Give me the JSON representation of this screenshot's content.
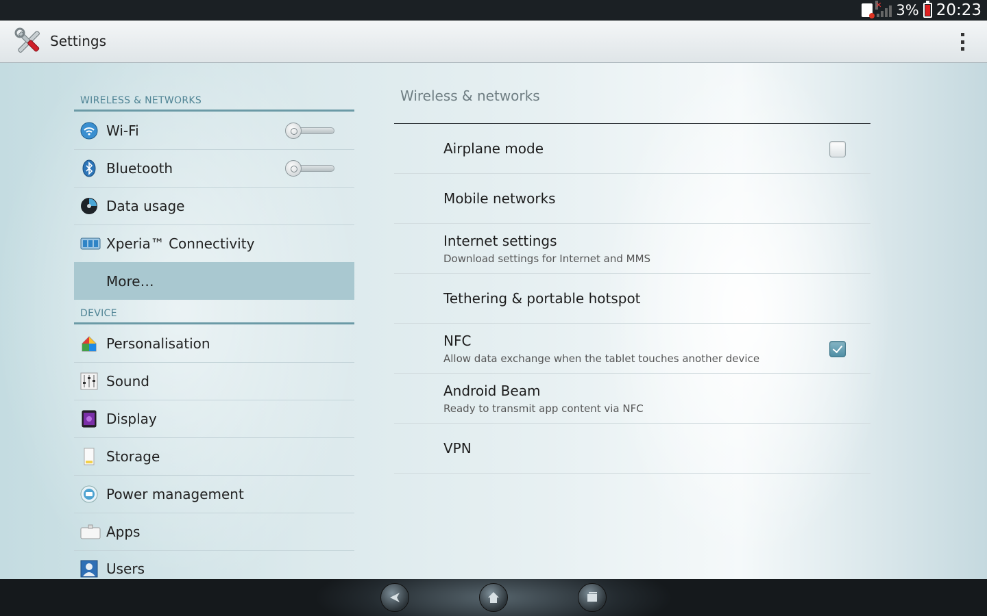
{
  "status_bar": {
    "battery_percent": "3%",
    "time": "20:23",
    "icons": [
      "sim-missing-icon",
      "signal-icon",
      "battery-low-icon"
    ]
  },
  "action_bar": {
    "title": "Settings",
    "icon": "settings-tools-icon",
    "overflow_icon": "overflow-menu-icon"
  },
  "left_pane": {
    "categories": [
      {
        "header": "WIRELESS & NETWORKS",
        "items": [
          {
            "label": "Wi-Fi",
            "icon": "wifi-icon",
            "toggle": "off"
          },
          {
            "label": "Bluetooth",
            "icon": "bluetooth-icon",
            "toggle": "off"
          },
          {
            "label": "Data usage",
            "icon": "data-usage-icon"
          },
          {
            "label": "Xperia™ Connectivity",
            "icon": "connectivity-icon"
          },
          {
            "label": "More…",
            "selected": true
          }
        ]
      },
      {
        "header": "DEVICE",
        "items": [
          {
            "label": "Personalisation",
            "icon": "personalisation-icon"
          },
          {
            "label": "Sound",
            "icon": "sound-icon"
          },
          {
            "label": "Display",
            "icon": "display-icon"
          },
          {
            "label": "Storage",
            "icon": "storage-icon"
          },
          {
            "label": "Power management",
            "icon": "power-management-icon"
          },
          {
            "label": "Apps",
            "icon": "apps-icon"
          },
          {
            "label": "Users",
            "icon": "users-icon"
          }
        ]
      }
    ]
  },
  "right_pane": {
    "title": "Wireless & networks",
    "items": [
      {
        "title": "Airplane mode",
        "summary": "",
        "checkbox": "unchecked"
      },
      {
        "title": "Mobile networks",
        "summary": ""
      },
      {
        "title": "Internet settings",
        "summary": "Download settings for Internet and MMS"
      },
      {
        "title": "Tethering & portable hotspot",
        "summary": ""
      },
      {
        "title": "NFC",
        "summary": "Allow data exchange when the tablet touches another device",
        "checkbox": "checked"
      },
      {
        "title": "Android Beam",
        "summary": "Ready to transmit app content via NFC"
      },
      {
        "title": "VPN",
        "summary": ""
      }
    ]
  },
  "nav_bar": {
    "buttons": [
      "back-icon",
      "home-icon",
      "recent-apps-icon"
    ]
  },
  "colors": {
    "accent": "#6b9aa6",
    "category_text": "#4e8394",
    "selected_bg": "#a9c8d0",
    "battery_low": "#e02020"
  }
}
